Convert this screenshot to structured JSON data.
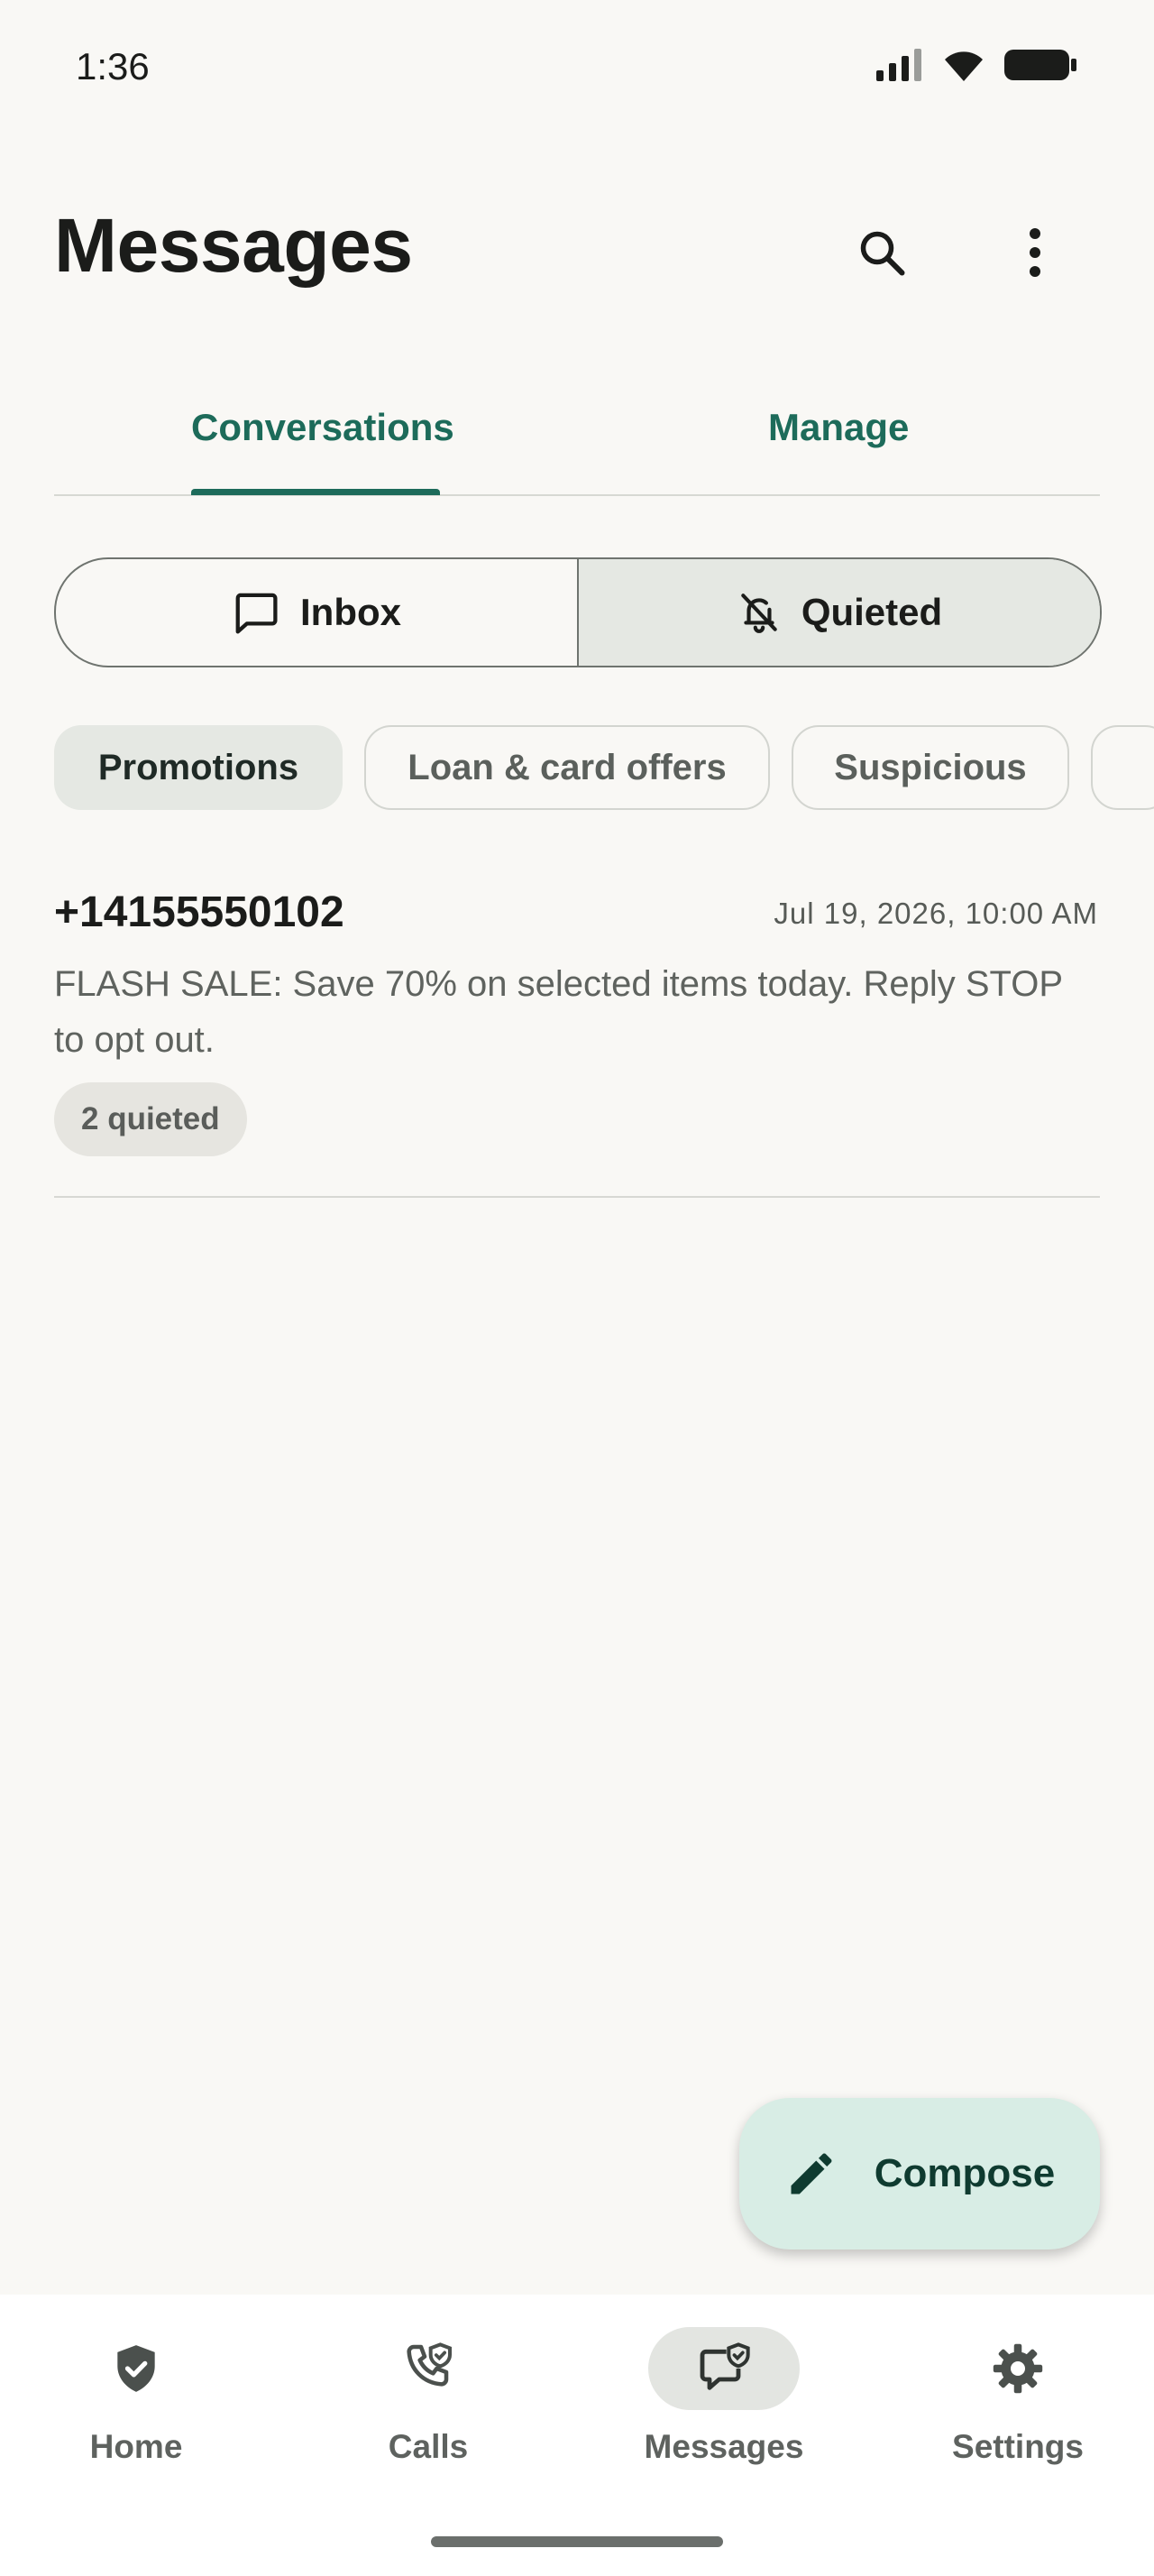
{
  "status_bar": {
    "time": "1:36",
    "icons": [
      "signal-icon",
      "wifi-icon",
      "battery-icon"
    ]
  },
  "header": {
    "title": "Messages",
    "search_icon": "search-icon",
    "menu_icon": "more-vert-icon"
  },
  "tabs": [
    {
      "label": "Conversations",
      "selected": true
    },
    {
      "label": "Manage",
      "selected": false
    }
  ],
  "segmented": [
    {
      "label": "Inbox",
      "icon": "chat-bubble-icon",
      "selected": false
    },
    {
      "label": "Quieted",
      "icon": "bell-off-icon",
      "selected": true
    }
  ],
  "chips": [
    {
      "label": "Promotions",
      "selected": true
    },
    {
      "label": "Loan & card offers",
      "selected": false
    },
    {
      "label": "Suspicious",
      "selected": false
    }
  ],
  "messages": [
    {
      "sender": "+14155550102",
      "date": "Jul 19, 2026, 10:00 AM",
      "body": "FLASH SALE: Save 70% on selected items today. Reply STOP to opt out.",
      "badge": "2 quieted"
    }
  ],
  "fab": {
    "label": "Compose",
    "icon": "pencil-icon"
  },
  "bottom_nav": [
    {
      "label": "Home",
      "icon": "shield-check-icon",
      "selected": false
    },
    {
      "label": "Calls",
      "icon": "phone-shield-icon",
      "selected": false
    },
    {
      "label": "Messages",
      "icon": "message-shield-icon",
      "selected": true
    },
    {
      "label": "Settings",
      "icon": "gear-icon",
      "selected": false
    }
  ],
  "colors": {
    "accent": "#1d6b5a",
    "background": "#f9f8f5",
    "fab": "#d8ede5"
  }
}
